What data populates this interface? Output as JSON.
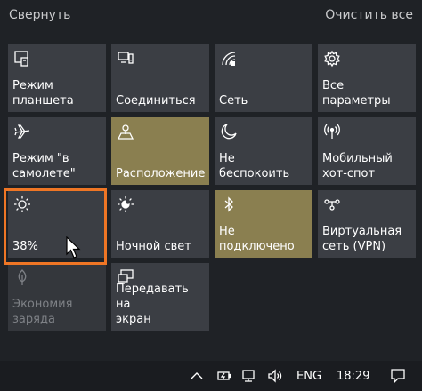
{
  "header": {
    "collapse_label": "Свернуть",
    "clear_all_label": "Очистить все"
  },
  "tiles": [
    {
      "label": "Режим\nпланшета",
      "icon": "tablet-mode-icon",
      "state": "normal"
    },
    {
      "label": "Соединиться",
      "icon": "connect-icon",
      "state": "normal"
    },
    {
      "label": "Сеть",
      "icon": "network-icon",
      "state": "normal"
    },
    {
      "label": "Все параметры",
      "icon": "gear-icon",
      "state": "normal"
    },
    {
      "label": "Режим \"в\nсамолете\"",
      "icon": "airplane-icon",
      "state": "normal"
    },
    {
      "label": "Расположение",
      "icon": "location-icon",
      "state": "active"
    },
    {
      "label": "Не беспокоить",
      "icon": "moon-icon",
      "state": "normal"
    },
    {
      "label": "Мобильный\nхот-спот",
      "icon": "hotspot-icon",
      "state": "normal"
    },
    {
      "label": "38%",
      "icon": "brightness-icon",
      "state": "normal"
    },
    {
      "label": "Ночной свет",
      "icon": "night-light-icon",
      "state": "normal"
    },
    {
      "label": "Не\nподключено",
      "icon": "bluetooth-icon",
      "state": "active"
    },
    {
      "label": "Виртуальная\nсеть (VPN)",
      "icon": "vpn-icon",
      "state": "normal"
    },
    {
      "label": "Экономия\nзаряда",
      "icon": "battery-saver-icon",
      "state": "disabled"
    },
    {
      "label": "Передавать на\nэкран",
      "icon": "project-icon",
      "state": "normal"
    }
  ],
  "taskbar": {
    "language": "ENG",
    "time": "18:29",
    "icons": [
      "chevron-up-icon",
      "battery-icon",
      "network-icon",
      "volume-icon",
      "notification-icon"
    ]
  },
  "colors": {
    "background": "#1f2226",
    "tile": "#3b3e44",
    "tile_active": "#8a7f50",
    "highlight": "#ef7625"
  }
}
